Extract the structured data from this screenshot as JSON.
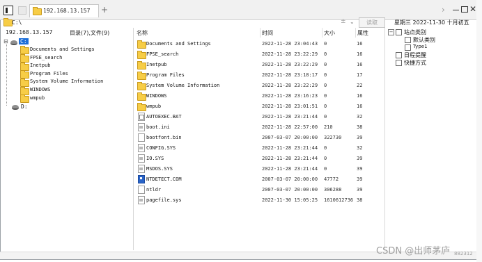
{
  "tab": {
    "label": "192.168.13.157",
    "add_label": "+"
  },
  "address": {
    "value": "C:\\",
    "read_button": "读取"
  },
  "date_line": "星期三  2022-11-30  十月初五",
  "left": {
    "host": "192.168.13.157",
    "count": "目录(7),文件(9)",
    "drive_c": "C:",
    "drive_d": "D:",
    "items": [
      "Documents and Settings",
      "FPSE_search",
      "Inetpub",
      "Program Files",
      "System Volume Information",
      "WINDOWS",
      "wmpub"
    ]
  },
  "columns": {
    "name": "名称",
    "time": "时间",
    "size": "大小",
    "attr": "属性"
  },
  "files": [
    {
      "name": "Documents and Settings",
      "time": "2022-11-28 23:04:43",
      "size": "0",
      "attr": "16",
      "icon": "folder-icon"
    },
    {
      "name": "FPSE_search",
      "time": "2022-11-28 23:22:29",
      "size": "0",
      "attr": "16",
      "icon": "folder-icon"
    },
    {
      "name": "Inetpub",
      "time": "2022-11-28 23:22:29",
      "size": "0",
      "attr": "16",
      "icon": "folder-icon"
    },
    {
      "name": "Program Files",
      "time": "2022-11-28 23:18:17",
      "size": "0",
      "attr": "17",
      "icon": "folder-icon"
    },
    {
      "name": "System Volume Information",
      "time": "2022-11-28 23:22:29",
      "size": "0",
      "attr": "22",
      "icon": "folder-icon"
    },
    {
      "name": "WINDOWS",
      "time": "2022-11-28 23:16:23",
      "size": "0",
      "attr": "16",
      "icon": "folder-icon"
    },
    {
      "name": "wmpub",
      "time": "2022-11-28 23:01:51",
      "size": "0",
      "attr": "16",
      "icon": "folder-icon"
    },
    {
      "name": "AUTOEXEC.BAT",
      "time": "2022-11-28 23:21:44",
      "size": "0",
      "attr": "32",
      "icon": "batch-file-icon"
    },
    {
      "name": "boot.ini",
      "time": "2022-11-28 22:57:00",
      "size": "210",
      "attr": "38",
      "icon": "config-file-icon"
    },
    {
      "name": "bootfont.bin",
      "time": "2007-03-07 20:00:00",
      "size": "322730",
      "attr": "39",
      "icon": "file-icon"
    },
    {
      "name": "CONFIG.SYS",
      "time": "2022-11-28 23:21:44",
      "size": "0",
      "attr": "32",
      "icon": "system-file-icon"
    },
    {
      "name": "IO.SYS",
      "time": "2022-11-28 23:21:44",
      "size": "0",
      "attr": "39",
      "icon": "system-file-icon"
    },
    {
      "name": "MSDOS.SYS",
      "time": "2022-11-28 23:21:44",
      "size": "0",
      "attr": "39",
      "icon": "system-file-icon"
    },
    {
      "name": "NTDETECT.COM",
      "time": "2007-03-07 20:00:00",
      "size": "47772",
      "attr": "39",
      "icon": "executable-icon"
    },
    {
      "name": "ntldr",
      "time": "2007-03-07 20:00:00",
      "size": "306288",
      "attr": "39",
      "icon": "file-icon"
    },
    {
      "name": "pagefile.sys",
      "time": "2022-11-30 15:05:25",
      "size": "1610612736",
      "attr": "38",
      "icon": "system-file-icon"
    }
  ],
  "right_tree": {
    "site_category": "站点类别",
    "default_category": "默认类别",
    "type1": "Type1",
    "schedule_reminder": "日程提醒",
    "shortcuts": "快捷方式"
  },
  "watermark": {
    "text": "CSDN @出师茅庐",
    "id": "882312"
  }
}
